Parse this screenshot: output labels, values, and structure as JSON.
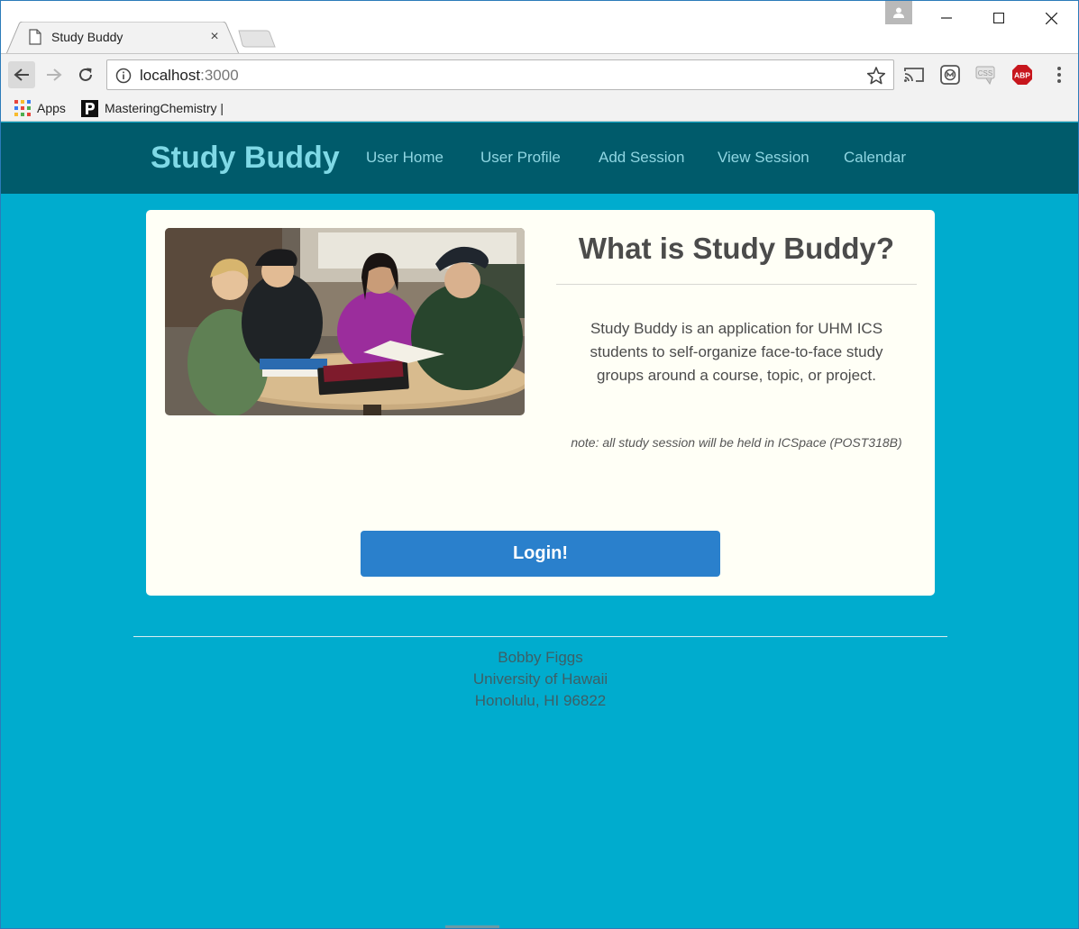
{
  "browser": {
    "tab_title": "Study Buddy",
    "tab_close": "×",
    "url_host": "localhost",
    "url_port": ":3000",
    "bookmarks": [
      {
        "label": "Apps"
      },
      {
        "label": "MasteringChemistry |"
      }
    ],
    "extensions": [
      "cast-icon",
      "mailvelope-icon",
      "css-viewer-icon",
      "adblock-plus-icon"
    ],
    "abp_label": "ABP",
    "css_label": "CSS"
  },
  "navbar": {
    "brand": "Study Buddy",
    "links": [
      {
        "label": "User Home"
      },
      {
        "label": "User Profile"
      },
      {
        "label": "Add Session"
      },
      {
        "label": "View Session"
      },
      {
        "label": "Calendar"
      }
    ]
  },
  "card": {
    "title": "What is Study Buddy?",
    "description": "Study Buddy is an application for UHM ICS students to self-organize face-to-face study groups around a course, topic, or project.",
    "note": "note: all study session will be held in ICSpace (POST318B)",
    "login_label": "Login!"
  },
  "footer": {
    "lines": [
      "Bobby Figgs",
      "University of Hawaii",
      "Honolulu, HI 96822"
    ]
  },
  "colors": {
    "page_bg": "#00acce",
    "navbar_bg": "#005b6b",
    "brand": "#7fd9e6",
    "card_bg": "#fffff6",
    "login_button": "#2a80cc",
    "abp_red": "#c7161d"
  }
}
